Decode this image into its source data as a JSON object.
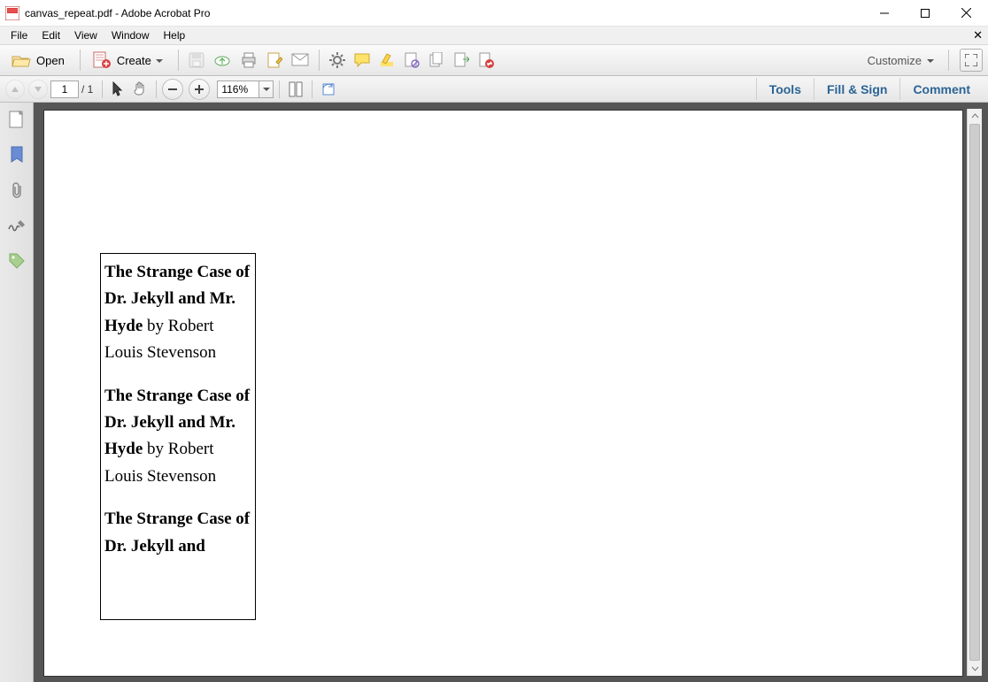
{
  "window": {
    "title": "canvas_repeat.pdf - Adobe Acrobat Pro"
  },
  "menu": {
    "file": "File",
    "edit": "Edit",
    "view": "View",
    "window": "Window",
    "help": "Help"
  },
  "toolbar": {
    "open": "Open",
    "create": "Create",
    "customize": "Customize"
  },
  "nav": {
    "page_current": "1",
    "page_total": "/  1",
    "zoom": "116%"
  },
  "panels": {
    "tools": "Tools",
    "fill": "Fill & Sign",
    "comment": "Comment"
  },
  "doc": {
    "title": "The Strange Case of Dr. Jekyll and Mr. Hyde",
    "by": " by ",
    "author": "Robert Louis Stevenson",
    "title3": "The Strange Case of Dr. Jekyll and"
  }
}
